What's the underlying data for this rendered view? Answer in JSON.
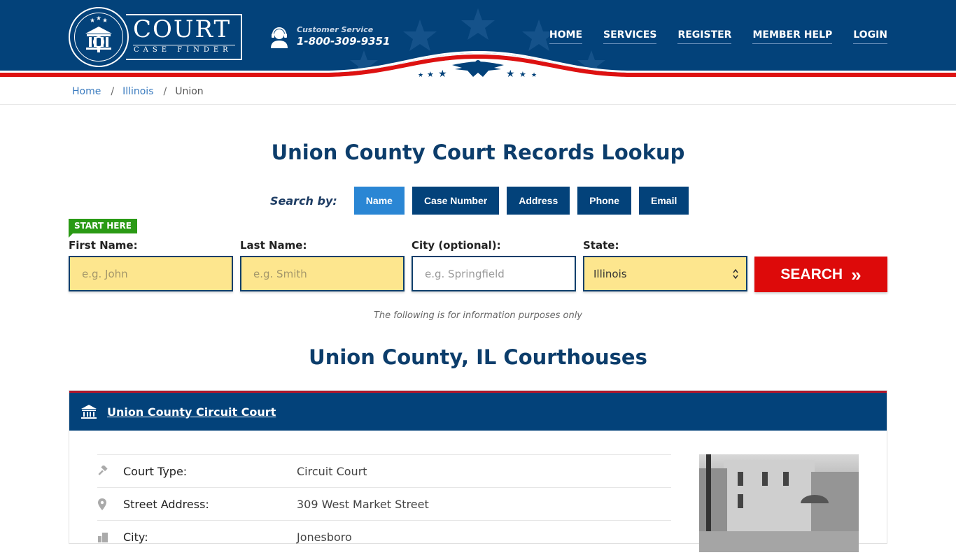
{
  "header": {
    "logo_title": "COURT",
    "logo_subtitle": "CASE FINDER",
    "customer_service_label": "Customer Service",
    "phone": "1-800-309-9351",
    "nav": [
      {
        "label": "HOME"
      },
      {
        "label": "SERVICES"
      },
      {
        "label": "REGISTER"
      },
      {
        "label": "MEMBER HELP"
      },
      {
        "label": "LOGIN"
      }
    ]
  },
  "breadcrumb": {
    "items": [
      {
        "label": "Home"
      },
      {
        "label": "Illinois"
      },
      {
        "label": "Union"
      }
    ],
    "separator": "/"
  },
  "page_title": "Union County Court Records Lookup",
  "search": {
    "search_by_label": "Search by:",
    "tabs": [
      {
        "label": "Name",
        "active": true
      },
      {
        "label": "Case Number",
        "active": false
      },
      {
        "label": "Address",
        "active": false
      },
      {
        "label": "Phone",
        "active": false
      },
      {
        "label": "Email",
        "active": false
      }
    ],
    "start_badge": "START HERE",
    "fields": {
      "first_name": {
        "label": "First Name:",
        "placeholder": "e.g. John",
        "value": ""
      },
      "last_name": {
        "label": "Last Name:",
        "placeholder": "e.g. Smith",
        "value": ""
      },
      "city": {
        "label": "City (optional):",
        "placeholder": "e.g.  Springfield",
        "value": ""
      },
      "state": {
        "label": "State:",
        "value": "Illinois"
      }
    },
    "button_label": "SEARCH",
    "button_icon": "»"
  },
  "info_note": "The following is for information purposes only",
  "courthouses_title": "Union County, IL Courthouses",
  "courthouse": {
    "name": "Union County Circuit Court",
    "rows": [
      {
        "icon": "gavel-icon",
        "key": "Court Type:",
        "value": "Circuit Court"
      },
      {
        "icon": "map-pin-icon",
        "key": "Street Address:",
        "value": "309 West Market Street"
      },
      {
        "icon": "city-icon",
        "key": "City:",
        "value": "Jonesboro"
      }
    ]
  },
  "colors": {
    "brand_navy": "#03427a",
    "accent_red": "#dd0a0a",
    "active_tab": "#2a86d4",
    "badge_green": "#2a9a15",
    "input_yellow": "#fde68e"
  }
}
